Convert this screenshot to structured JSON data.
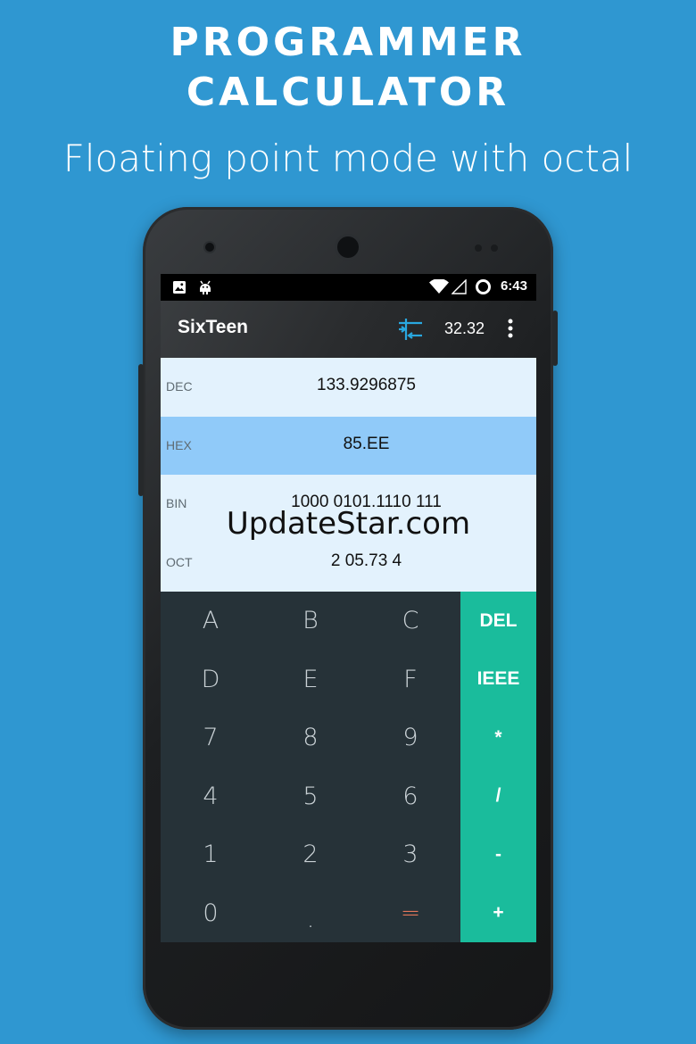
{
  "promo": {
    "title_line1": "PROGRAMMER",
    "title_line2": "CALCULATOR",
    "subtitle": "Floating point mode with octal"
  },
  "status_bar": {
    "time": "6:43",
    "icons": [
      "image-icon",
      "android-debug-icon",
      "wifi-icon",
      "signal-icon",
      "sync-ring-icon"
    ]
  },
  "app_bar": {
    "title": "SixTeen",
    "convert_icon": "convert-icon",
    "width_label": "32.32",
    "overflow_icon": "more-vert-icon"
  },
  "display": {
    "rows": [
      {
        "label": "DEC",
        "value": "133.9296875",
        "active": false
      },
      {
        "label": "HEX",
        "value": "85.EE",
        "active": true
      },
      {
        "label": "BIN",
        "value": "1000 0101.1110 111",
        "active": false
      },
      {
        "label": "OCT",
        "value": "2 05.73 4",
        "active": false
      }
    ],
    "watermark": "UpdateStar.com"
  },
  "keypad": {
    "digit_rows": [
      [
        "A",
        "B",
        "C"
      ],
      [
        "D",
        "E",
        "F"
      ],
      [
        "7",
        "8",
        "9"
      ],
      [
        "4",
        "5",
        "6"
      ],
      [
        "1",
        "2",
        "3"
      ],
      [
        "0",
        ".",
        "="
      ]
    ],
    "ops": [
      "DEL",
      "IEEE",
      "*",
      "/",
      "-",
      "+"
    ]
  },
  "colors": {
    "background": "#2f97d1",
    "keypad_dark": "#263238",
    "ops_accent": "#1abc9c",
    "display_row": "#e3f2fd",
    "display_active_row": "#90caf9",
    "equals_key": "#e4775a",
    "convert_icon": "#29a8e0"
  }
}
